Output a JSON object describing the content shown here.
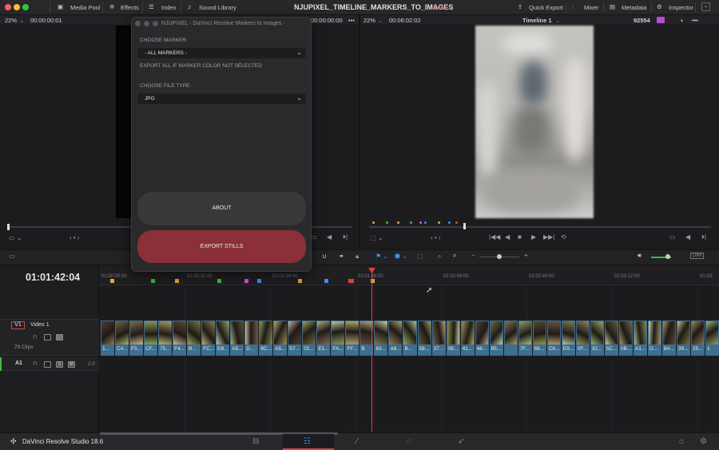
{
  "window": {
    "project_title": "NJUPIXEL_TIMELINE_MARKERS_TO_IMAGES",
    "project_status": "Edited"
  },
  "toolbar": {
    "media_pool": "Media Pool",
    "effects": "Effects",
    "index": "Index",
    "sound_library": "Sound Library",
    "quick_export": "Quick Export",
    "mixer": "Mixer",
    "metadata": "Metadata",
    "inspector": "Inspector"
  },
  "viewer": {
    "left_zoom": "22%",
    "left_timecode": "00:00:00:01",
    "left_time2": "00:00:00:00",
    "right_zoom": "22%",
    "right_timecode": "00:06:02:02",
    "timeline_name": "Timeline 1",
    "frame_count": "92554"
  },
  "dialog": {
    "title": "NJUPIXEL - DaVinci Resolve Markers to Images -",
    "marker_label": "CHOOSE MARKER:",
    "marker_value": "- ALL MARKERS -",
    "marker_hint": "EXPORT ALL IF MARKER COLOR NOT SELECTED",
    "filetype_label": "CHOOSE FILE TYPE:",
    "filetype_value": "JPG",
    "about_button": "ABOUT",
    "export_button": "EXPORT STILLS"
  },
  "timeline": {
    "timecode": "01:01:42:04",
    "ruler_labels": [
      "01:00:00:00",
      "01:00:32:00",
      "01:01:04:00",
      "01:01:36:00",
      "01:02:08:00",
      "01:02:40:00",
      "01:03:12:00",
      "01:03:"
    ],
    "markers": [
      {
        "color": "#e8a33a"
      },
      {
        "color": "#3dbb3d"
      },
      {
        "color": "#e8a33a"
      },
      {
        "color": "#3dbb3d"
      },
      {
        "color": "#e04ad8"
      },
      {
        "color": "#3b8ff0"
      },
      {
        "color": "#e8a33a"
      },
      {
        "color": "#3b8ff0"
      },
      {
        "color": "#e0413c"
      },
      {
        "color": "#e8a33a"
      }
    ],
    "tracks": {
      "v1_badge": "V1",
      "v1_name": "Video 1",
      "v1_clip_count": "79 Clips",
      "a1_badge": "A1",
      "a1_level": "2.0"
    },
    "clip_labels": [
      "1...",
      "C4...",
      "F5...",
      "CF...",
      "75...",
      "F4...",
      "B...",
      "FC...",
      "E8...",
      "A5...",
      "D...",
      "9C...",
      "A5...",
      "57...",
      "01...",
      "E1...",
      "FA...",
      "FF...",
      "B",
      "63...",
      "A8...",
      "B...",
      "58...",
      "37...",
      "08...",
      "41...",
      "46...",
      "85...",
      "",
      "7F...",
      "66...",
      "C6...",
      "E9...",
      "0F...",
      "32...",
      "5C...",
      "0B...",
      "A1...",
      "D...",
      "8A...",
      "39...",
      "25...",
      "1"
    ]
  },
  "app": {
    "brand": "DaVinci Resolve Studio 18.6"
  }
}
